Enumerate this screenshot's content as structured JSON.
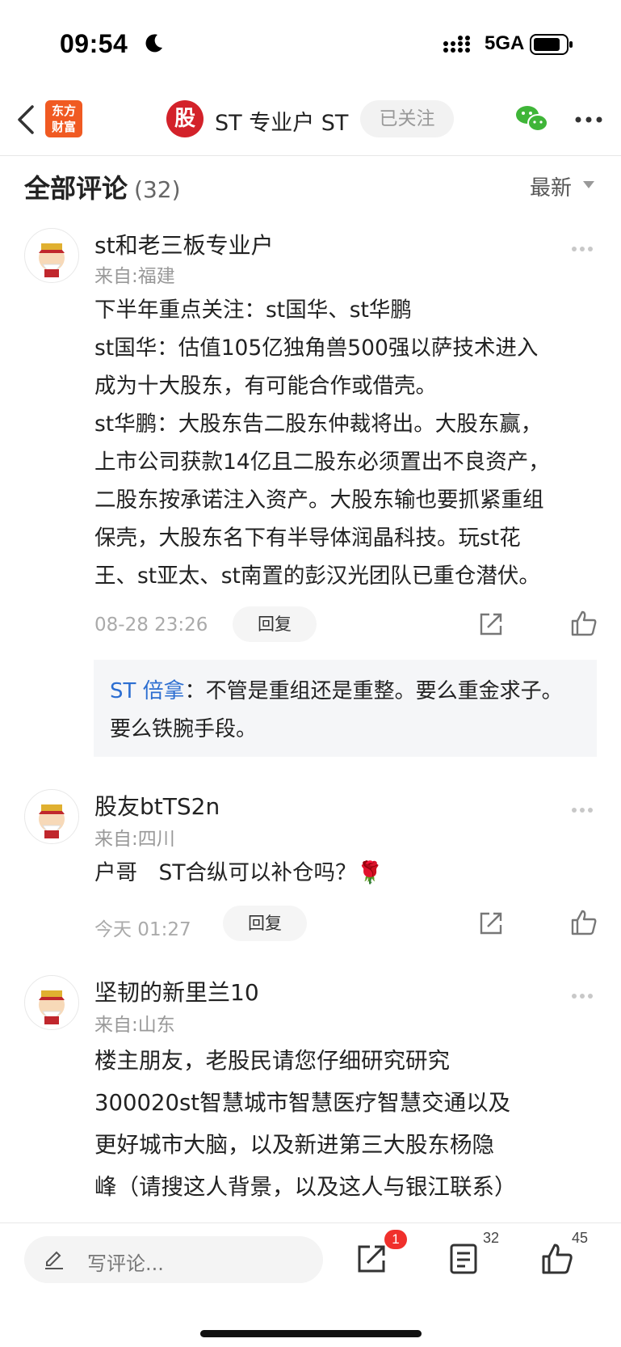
{
  "status": {
    "time": "09:54",
    "network": "5GA"
  },
  "nav": {
    "app_logo_line1": "东方",
    "app_logo_line2": "财富",
    "stock_logo": "股",
    "title": "ST 专业户 ST",
    "follow_label": "已关注"
  },
  "section": {
    "title": "全部评论",
    "count": "(32)",
    "sort_label": "最新"
  },
  "comments": [
    {
      "username": "st和老三板专业户",
      "location": "来自:福建",
      "lines": [
        "下半年重点关注：st国华、st华鹏",
        "st国华：估值105亿独角兽500强以萨技术进入",
        "成为十大股东，有可能合作或借壳。",
        "st华鹏：大股东告二股东仲裁将出。大股东赢，",
        "上市公司获款14亿且二股东必须置出不良资产，",
        "二股东按承诺注入资产。大股东输也要抓紧重组",
        "保壳，大股东名下有半导体润晶科技。玩st花",
        "王、st亚太、st南置的彭汉光团队已重仓潜伏。"
      ],
      "time": "08-28 23:26",
      "reply_label": "回复",
      "sub_reply": {
        "name": "ST 倍拿",
        "sep": "：",
        "text": "不管是重组还是重整。要么重金求子。要么铁腕手段。"
      }
    },
    {
      "username": "股友btTS2n",
      "location": "来自:四川",
      "lines": [
        "户哥　ST合纵可以补仓吗？🌹"
      ],
      "time": "今天 01:27",
      "reply_label": "回复"
    },
    {
      "username": "坚韧的新里兰10",
      "location": "来自:山东",
      "lines": [
        "楼主朋友，老股民请您仔细研究研究",
        " 300020st智慧城市智慧医疗智慧交通以及",
        "更好城市大脑，以及新进第三大股东杨隐",
        "峰（请搜这人背景，以及这人与银江联系）"
      ]
    }
  ],
  "bottom": {
    "input_placeholder": "写评论...",
    "share_badge": "1",
    "comment_count": "32",
    "like_count": "45"
  }
}
